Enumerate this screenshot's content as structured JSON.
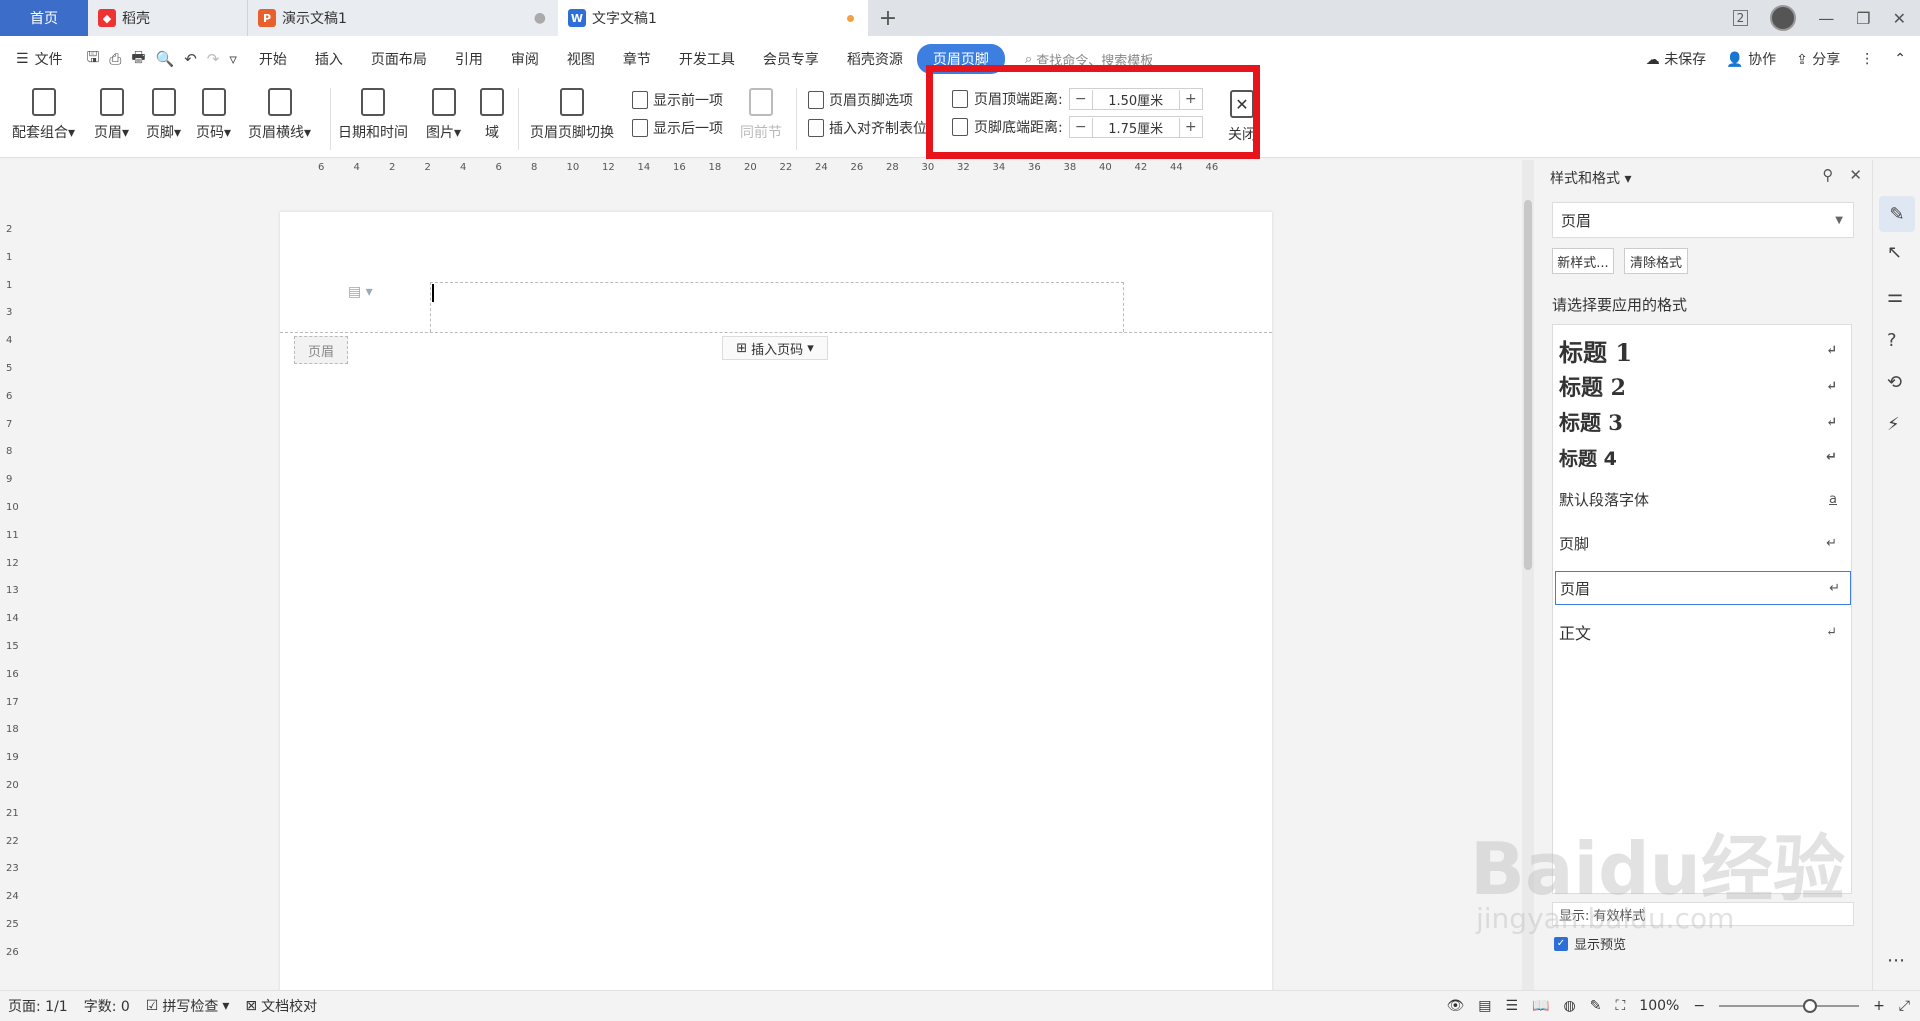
{
  "tabs": {
    "home": "首页",
    "t1": "稻壳",
    "t2": "演示文稿1",
    "t3": "文字文稿1"
  },
  "window": {
    "page_indicator": "2"
  },
  "menu": {
    "file": "文件",
    "items": [
      "开始",
      "插入",
      "页面布局",
      "引用",
      "审阅",
      "视图",
      "章节",
      "开发工具",
      "会员专享",
      "稻壳资源"
    ],
    "active": "页眉页脚",
    "search": "查找命令、搜索模板",
    "unsaved": "未保存",
    "collab": "协作",
    "share": "分享"
  },
  "ribbon": {
    "combo": "配套组合",
    "header": "页眉",
    "footer": "页脚",
    "pagenum": "页码",
    "headerline": "页眉横线",
    "datetime": "日期和时间",
    "picture": "图片",
    "field": "域",
    "switch": "页眉页脚切换",
    "prev": "显示前一项",
    "next": "显示后一项",
    "same": "同前节",
    "options": "页眉页脚选项",
    "align_tab": "插入对齐制表位",
    "top_dist_label": "页眉顶端距离:",
    "top_dist_value": "1.50厘米",
    "bottom_dist_label": "页脚底端距离:",
    "bottom_dist_value": "1.75厘米",
    "close": "关闭"
  },
  "ruler": {
    "h": [
      "6",
      "4",
      "2",
      "2",
      "4",
      "6",
      "8",
      "10",
      "12",
      "14",
      "16",
      "18",
      "20",
      "22",
      "24",
      "26",
      "28",
      "30",
      "32",
      "34",
      "36",
      "38",
      "40",
      "42",
      "44",
      "46"
    ],
    "v": [
      "2",
      "1",
      "1",
      "3",
      "4",
      "5",
      "6",
      "7",
      "8",
      "9",
      "10",
      "11",
      "12",
      "13",
      "14",
      "15",
      "16",
      "17",
      "18",
      "19",
      "20",
      "21",
      "22",
      "23",
      "24",
      "25",
      "26"
    ]
  },
  "page": {
    "header_label": "页眉",
    "insert_pagenum": "插入页码"
  },
  "panel": {
    "title": "样式和格式",
    "current": "页眉",
    "new_style": "新样式...",
    "clear": "清除格式",
    "choose_label": "请选择要应用的格式",
    "styles": [
      "标题 1",
      "标题 2",
      "标题 3",
      "标题 4",
      "默认段落字体",
      "页脚",
      "页眉",
      "正文"
    ],
    "show": "显示: 有效样式",
    "preview": "显示预览"
  },
  "status": {
    "page": "页面: 1/1",
    "words": "字数: 0",
    "spell": "拼写检查",
    "proof": "文档校对",
    "zoom": "100%"
  },
  "watermark": {
    "main": "Baidu经验",
    "sub": "jingyan.baidu.com"
  }
}
